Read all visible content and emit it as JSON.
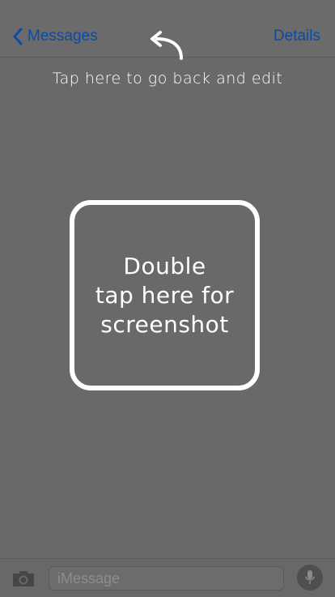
{
  "navbar": {
    "back_label": "Messages",
    "details_label": "Details"
  },
  "hint_text": "Tap here to go back and edit",
  "tap_box_text": "Double\ntap here for\nscreenshot",
  "compose": {
    "placeholder": "iMessage",
    "left_icon": "camera-icon",
    "right_icon": "microphone-icon"
  },
  "colors": {
    "background": "#696969",
    "link": "#0a4ca3",
    "text": "#ffffff"
  }
}
